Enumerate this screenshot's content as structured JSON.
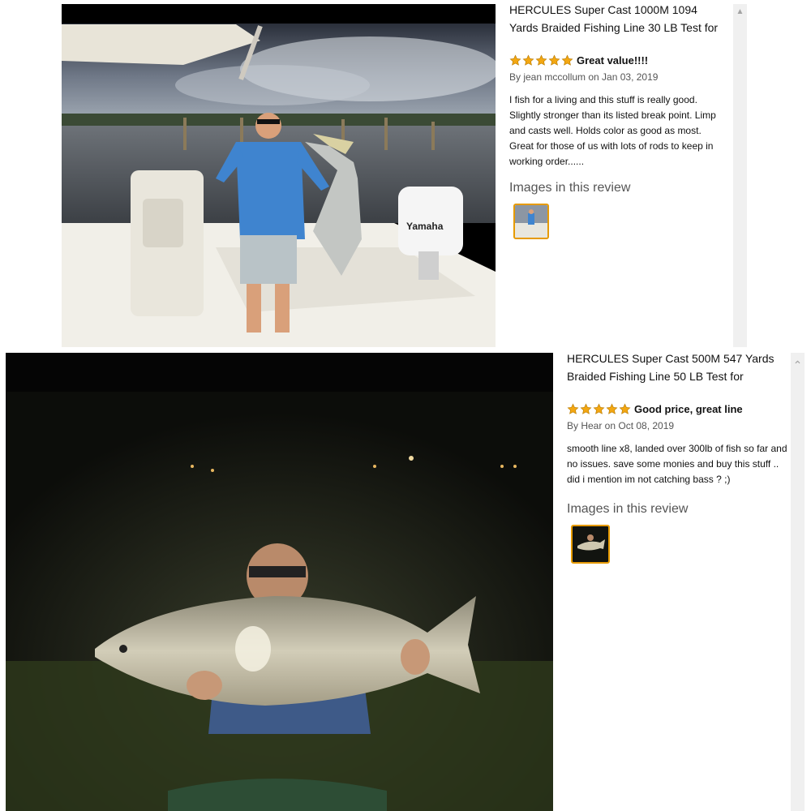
{
  "reviews": [
    {
      "product_title": "HERCULES Super Cast 1000M 1094 Yards Braided Fishing Line 30 LB Test for",
      "rating": 5,
      "review_title": "Great value!!!!",
      "byline": "By jean mccollum on Jan 03, 2019",
      "body": "I fish for a living and this stuff is really good. Slightly stronger than its listed break point. Limp and casts well. Holds color as good as most. Great for those of us with lots of rods to keep in working order......",
      "images_heading": "Images in this review",
      "photo_icon": "boat-angler-photo",
      "thumb_icon": "review-thumbnail"
    },
    {
      "product_title": "HERCULES Super Cast 500M 547 Yards Braided Fishing Line 50 LB Test for",
      "rating": 5,
      "review_title": "Good price, great line",
      "byline": "By Hear on Oct 08, 2019",
      "body": "smooth line x8, landed over 300lb of fish so far and no issues. save some monies and buy this stuff .. did i mention im not catching bass ? ;)",
      "images_heading": "Images in this review",
      "photo_icon": "night-carp-photo",
      "thumb_icon": "review-thumbnail"
    }
  ],
  "colors": {
    "star": "#f3a712",
    "thumb_border": "#e69a00",
    "scrollbar": "#f0f0f0"
  }
}
